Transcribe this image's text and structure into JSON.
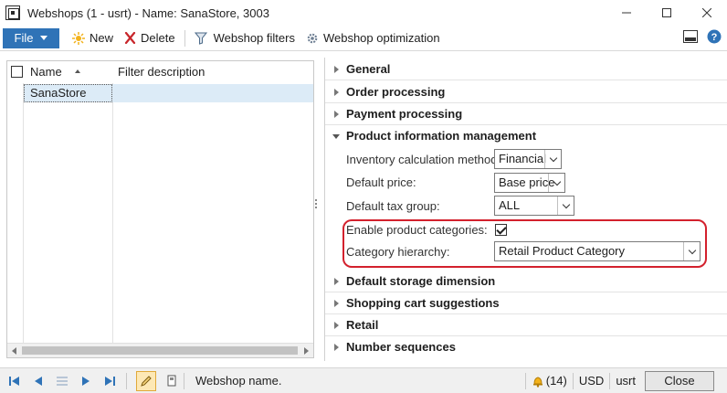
{
  "window": {
    "title": "Webshops (1 - usrt) - Name: SanaStore, 3003"
  },
  "toolbar": {
    "file_label": "File",
    "new_label": "New",
    "delete_label": "Delete",
    "webshop_filters_label": "Webshop filters",
    "webshop_optimization_label": "Webshop optimization"
  },
  "grid": {
    "columns": [
      "Name",
      "Filter description"
    ],
    "rows": [
      {
        "name": "SanaStore",
        "filter_description": ""
      }
    ]
  },
  "fasttabs": {
    "general": "General",
    "order_processing": "Order processing",
    "payment_processing": "Payment processing",
    "product_information_management": "Product information management",
    "default_storage_dimension": "Default storage dimension",
    "shopping_cart_suggestions": "Shopping cart suggestions",
    "retail": "Retail",
    "number_sequences": "Number sequences"
  },
  "pim": {
    "inventory_calc_label": "Inventory calculation method:",
    "inventory_calc_value": "Financial",
    "default_price_label": "Default price:",
    "default_price_value": "Base price",
    "default_tax_group_label": "Default tax group:",
    "default_tax_group_value": "ALL",
    "enable_categories_label": "Enable product categories:",
    "enable_categories_checked": true,
    "category_hierarchy_label": "Category hierarchy:",
    "category_hierarchy_value": "Retail Product Category"
  },
  "statusbar": {
    "status_text": "Webshop name.",
    "notifications": "(14)",
    "currency": "USD",
    "company": "usrt",
    "close_label": "Close"
  },
  "colors": {
    "file_button": "#2f73b7",
    "selected_row": "#dcebf7",
    "highlight_border": "#d3212d",
    "nav_arrows": "#2f73b7"
  }
}
